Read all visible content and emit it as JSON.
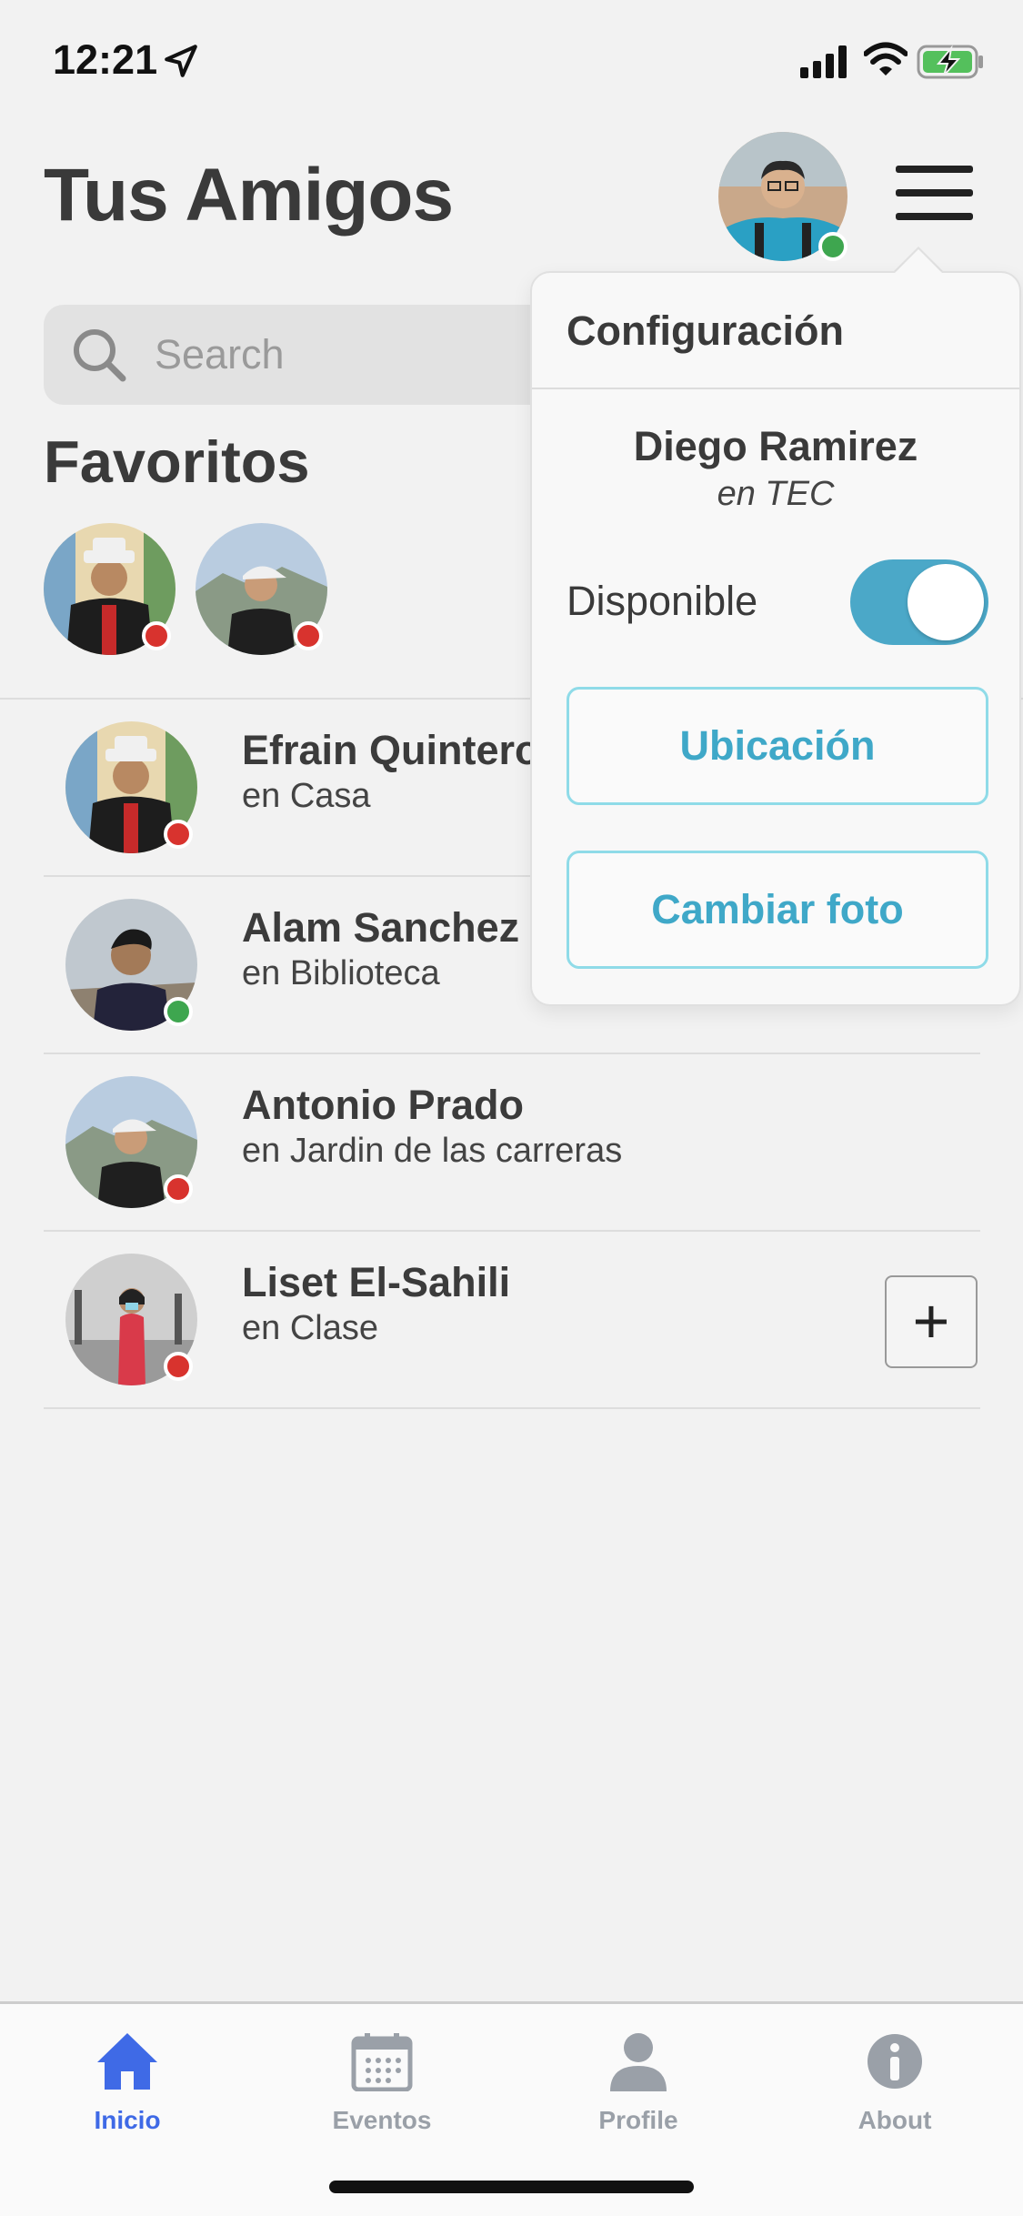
{
  "status_bar": {
    "time": "12:21"
  },
  "header": {
    "title": "Tus Amigos"
  },
  "search": {
    "placeholder": "Search"
  },
  "favorites": {
    "title": "Favoritos"
  },
  "friends": [
    {
      "name": "Efrain Quintero",
      "location": "en Casa",
      "status": "busy"
    },
    {
      "name": "Alam Sanchez",
      "location": "en Biblioteca",
      "status": "available"
    },
    {
      "name": "Antonio Prado",
      "location": "en Jardin de las carreras",
      "status": "busy"
    },
    {
      "name": "Liset El-Sahili",
      "location": "en Clase",
      "status": "busy",
      "add_label": "+"
    }
  ],
  "config": {
    "title": "Configuración",
    "user_name": "Diego Ramirez",
    "user_location": "en TEC",
    "available_label": "Disponible",
    "available": true,
    "location_button": "Ubicación",
    "photo_button": "Cambiar foto"
  },
  "tabs": [
    {
      "label": "Inicio",
      "icon": "home-icon",
      "active": true
    },
    {
      "label": "Eventos",
      "icon": "calendar-icon",
      "active": false
    },
    {
      "label": "Profile",
      "icon": "person-icon",
      "active": false
    },
    {
      "label": "About",
      "icon": "info-icon",
      "active": false
    }
  ],
  "colors": {
    "accent": "#3f6ae6",
    "teal": "#3fa8c8",
    "online": "#3ea64f",
    "busy": "#d8332e"
  }
}
